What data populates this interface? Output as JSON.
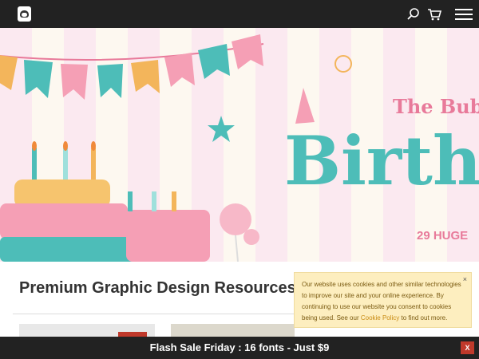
{
  "header": {
    "logo_icon": "bear-logo-icon",
    "search_icon": "search-icon",
    "cart_icon": "cart-icon",
    "menu_icon": "hamburger-menu-icon"
  },
  "hero": {
    "title_top": "The Bubbly",
    "title_main": "Birthd",
    "subtitle": "29 HUGE"
  },
  "main": {
    "heading": "Premium Graphic Design Resources"
  },
  "cookie": {
    "text_before": "Our website uses cookies and other similar technologies to improve our site and your online experience. By continuing to use our website you consent to cookies being used. See our ",
    "link": "Cookie Policy",
    "text_after": " to find out more.",
    "close": "×"
  },
  "footer_bar": {
    "flash_text": "Flash Sale Friday : 16 fonts - Just $9",
    "close_label": "X"
  },
  "colors": {
    "topbar": "#222222",
    "accent_teal": "#4dbdb8",
    "accent_pink": "#e87a9a",
    "cookie_bg": "#fdeebf",
    "close_red": "#c0392b"
  }
}
